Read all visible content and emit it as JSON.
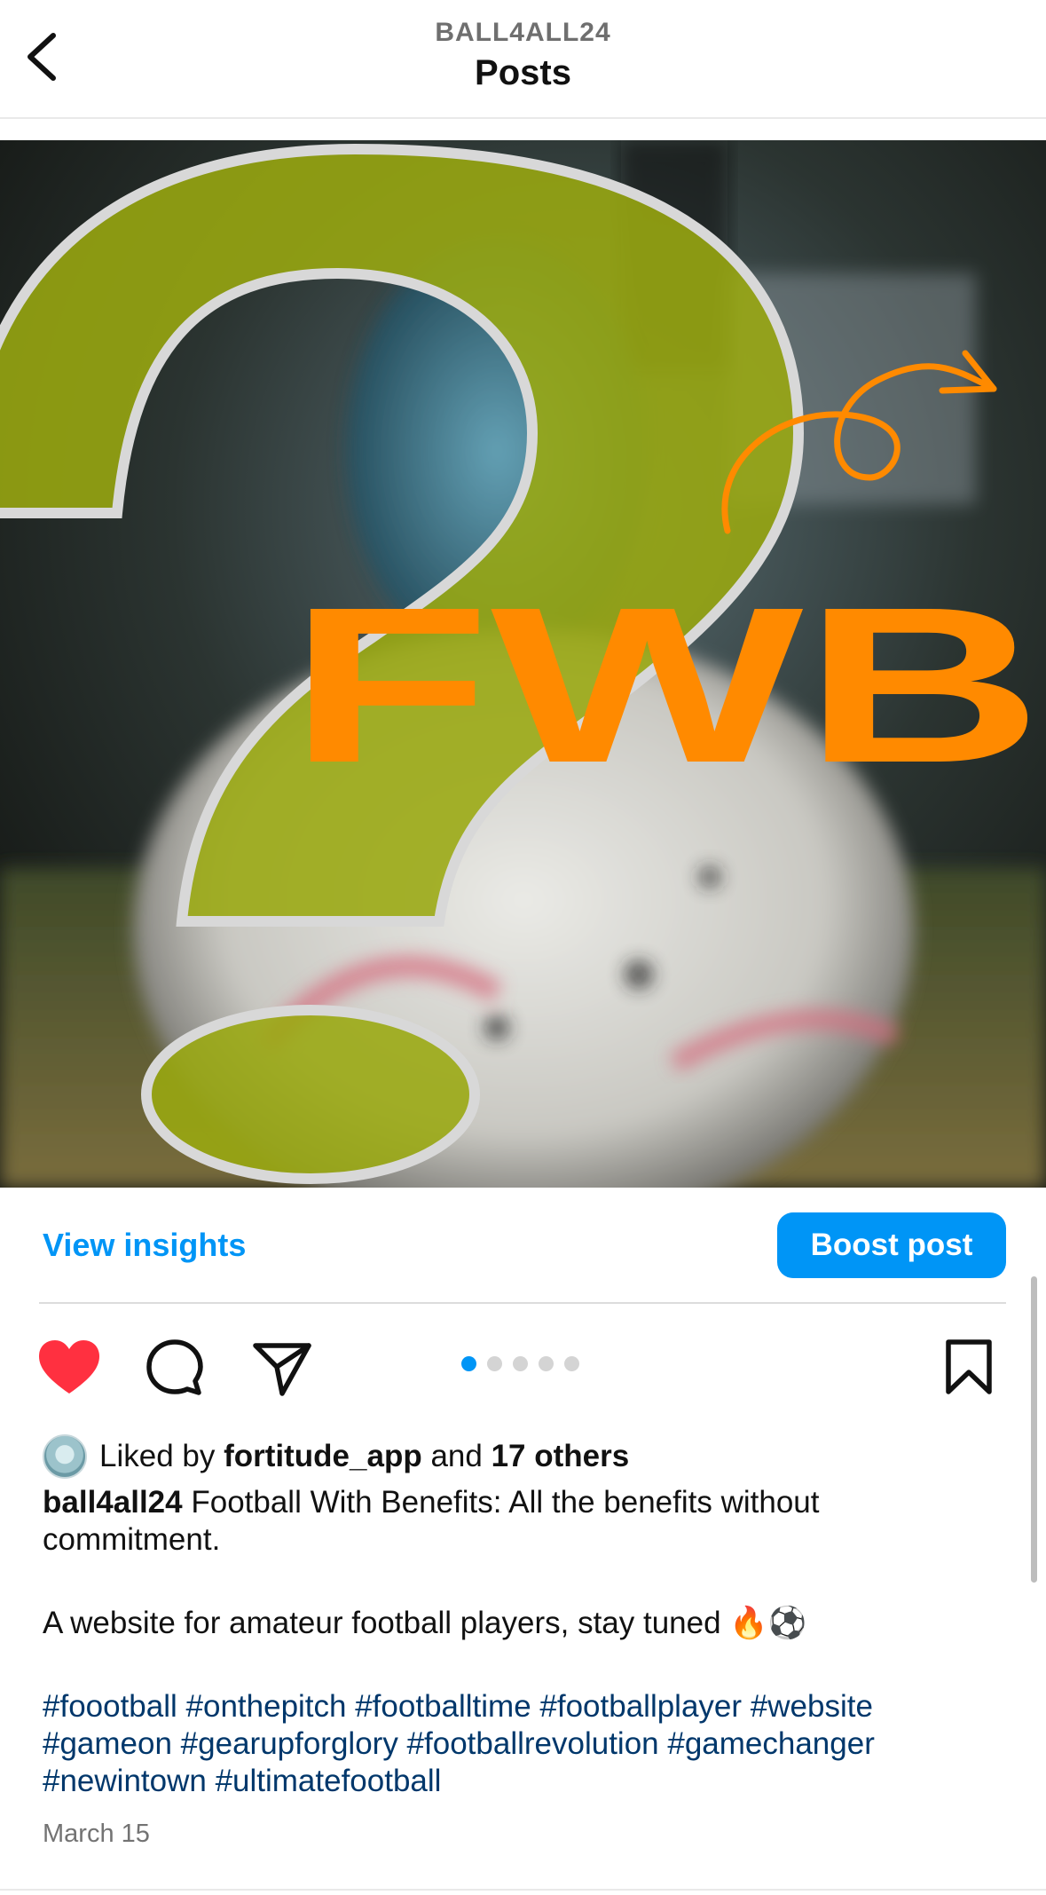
{
  "header": {
    "account_handle": "BALL4ALL24",
    "title": "Posts",
    "back_icon": "chevron-left-icon"
  },
  "post": {
    "image": {
      "overlay_text": "FWB",
      "colors": {
        "question_mark": "#9aa810",
        "overlay_text": "#ff8a00",
        "arrow": "#ff8a00",
        "outline": "#d8d8d8"
      }
    },
    "insights_link": "View insights",
    "boost_button": "Boost post",
    "actions": {
      "like_icon": "heart-filled-icon",
      "comment_icon": "comment-icon",
      "share_icon": "send-icon",
      "save_icon": "bookmark-icon",
      "like_color": "#ff3040"
    },
    "carousel": {
      "count": 5,
      "active_index": 0,
      "active_color": "#0095f6"
    },
    "likes": {
      "prefix": "Liked by",
      "user": "fortitude_app",
      "conjunction": "and",
      "others": "17 others"
    },
    "caption": {
      "username": "ball4all24",
      "line1": "Football With Benefits: All the benefits without commitment.",
      "line2": "A website for amateur football players, stay tuned 🔥⚽",
      "hashtags": "#foootball #onthepitch #footballtime #footballplayer #website #gameon #gearupforglory #footballrevolution #gamechanger #newintown #ultimatefootball"
    },
    "date": "March 15"
  }
}
